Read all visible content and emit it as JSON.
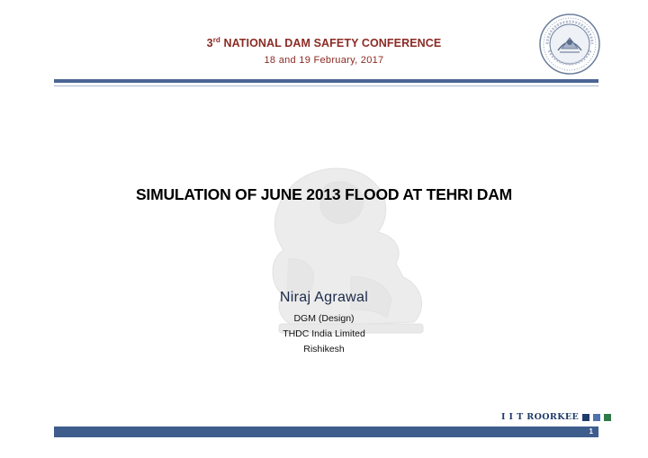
{
  "header": {
    "conf_number": "3",
    "conf_suffix": "rd",
    "conf_title": " NATIONAL DAM SAFETY CONFERENCE",
    "conf_date": "18 and 19 February, 2017"
  },
  "title": "SIMULATION OF JUNE 2013 FLOOD AT TEHRI DAM",
  "presenter": {
    "name": "Niraj Agrawal",
    "designation": "DGM (Design)",
    "organization": "THDC India Limited",
    "location": "Rishikesh"
  },
  "footer": {
    "brand": "I I T ROORKEE",
    "page_number": "1"
  },
  "colors": {
    "header_text": "#8b2b24",
    "rule": "#4a6694",
    "footer_bar": "#3e5d8d",
    "brand_squares": [
      "#1f3b6b",
      "#4e73b0",
      "#2f7a4a"
    ]
  },
  "icons": {
    "seal": "iit-roorkee-seal-icon",
    "watermark": "lion-watermark-icon"
  }
}
